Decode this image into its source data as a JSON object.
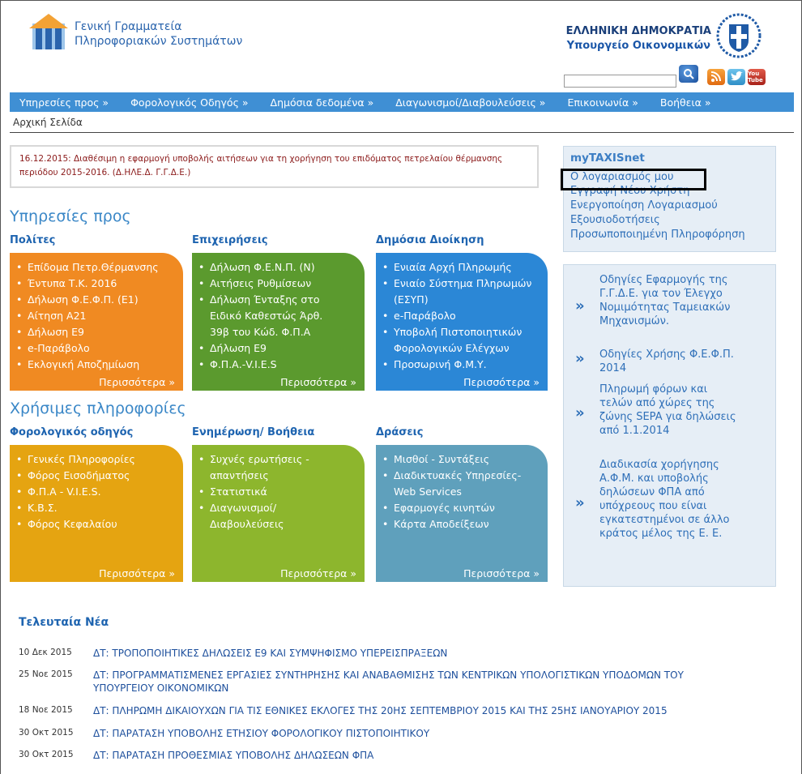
{
  "header": {
    "brand_line1": "Γενική Γραμματεία",
    "brand_line2": "Πληροφοριακών Συστημάτων",
    "gov_line1": "ΕΛΛΗΝΙΚΗ ΔΗΜΟΚΡΑΤΙΑ",
    "gov_line2": "Υπουργείο Οικονομικών",
    "search_value": "",
    "youtube_label": "You Tube"
  },
  "nav": {
    "items": [
      "Υπηρεσίες προς »",
      "Φορολογικός Οδηγός »",
      "Δημόσια δεδομένα »",
      "Διαγωνισμοί/Διαβουλεύσεις »",
      "Επικοινωνία »",
      "Βοήθεια »"
    ]
  },
  "breadcrumb": "Αρχική Σελίδα",
  "notice": "16.12.2015: Διαθέσιμη η εφαρμογή υποβολής αιτήσεων για τη χορήγηση του επιδόματος πετρελαίου θέρμανσης περιόδου 2015-2016. (Δ.ΗΛΕ.Δ. Γ.Γ.Δ.Ε.)",
  "services": {
    "title": "Υπηρεσίες προς",
    "columns": [
      {
        "title": "Πολίτες",
        "items": [
          "Επίδομα Πετρ.Θέρμανσης",
          "Έντυπα Τ.Κ. 2016",
          "Δήλωση Φ.Ε.Φ.Π. (Ε1)",
          "Αίτηση Α21",
          "Δήλωση Ε9",
          "e-Παράβολο",
          "Εκλογική Αποζημίωση"
        ],
        "more": "Περισσότερα »"
      },
      {
        "title": "Επιχειρήσεις",
        "items": [
          "Δήλωση Φ.Ε.Ν.Π. (Ν)",
          "Αιτήσεις Ρυθμίσεων",
          "Δήλωση Ένταξης στο Ειδικό Καθεστώς  Άρθ. 39β του Κώδ. Φ.Π.Α",
          "Δήλωση Ε9",
          "Φ.Π.Α.-V.I.E.S"
        ],
        "more": "Περισσότερα »"
      },
      {
        "title": "Δημόσια Διοίκηση",
        "items": [
          "Ενιαία Αρχή Πληρωμής",
          "Ενιαίο Σύστημα Πληρωμών (ΕΣΥΠ)",
          "e-Παράβολο",
          "Υποβολή Πιστοποιητικών Φορολογικών Ελέγχων",
          "Προσωρινή Φ.Μ.Υ."
        ],
        "more": "Περισσότερα »"
      }
    ]
  },
  "useful": {
    "title": "Χρήσιμες πληροφορίες",
    "columns": [
      {
        "title": "Φορολογικός οδηγός",
        "items": [
          "Γενικές Πληροφορίες",
          "Φόρος Εισοδήματος",
          "Φ.Π.Α - V.I.E.S.",
          "Κ.Β.Σ.",
          "Φόρος Κεφαλαίου"
        ],
        "more": "Περισσότερα »"
      },
      {
        "title": "Ενημέρωση/ Βοήθεια",
        "items": [
          "Συχνές ερωτήσεις - απαντήσεις",
          "Στατιστικά",
          "Διαγωνισμοί/ Διαβουλεύσεις"
        ],
        "more": "Περισσότερα »"
      },
      {
        "title": "Δράσεις",
        "items": [
          "Μισθοί - Συντάξεις",
          "Διαδικτυακές Υπηρεσίες-Web Services",
          "Εφαρμογές κινητών",
          "Κάρτα Αποδείξεων"
        ],
        "more": "Περισσότερα »"
      }
    ]
  },
  "mytaxisnet": {
    "title": "myTAXISnet",
    "links": [
      "Ο λογαριασμός μου",
      "Εγγραφή Νέου Χρήστη",
      "Ενεργοποίηση Λογαριασμού",
      "Εξουσιοδοτήσεις",
      "Προσωποποιημένη Πληροφόρηση"
    ]
  },
  "info_links": [
    "Οδηγίες Εφαρμογής της Γ.Γ.Δ.Ε. για τον Έλεγχο Νομιμότητας Ταμειακών Μηχανισμών.",
    "Οδηγίες Χρήσης Φ.Ε.Φ.Π. 2014",
    "Πληρωμή φόρων και τελών από χώρες της ζώνης SEPA για δηλώσεις από 1.1.2014",
    "Διαδικασία χορήγησης Α.Φ.Μ. και υποβολής δηλώσεων ΦΠΑ από υπόχρεους που είναι εγκατεστημένοι σε άλλο κράτος μέλος της Ε. Ε."
  ],
  "info_arrow": "»",
  "news": {
    "title": "Τελευταία Νέα",
    "items": [
      {
        "date": "10 Δεκ 2015",
        "text": "ΔΤ: ΤΡΟΠΟΠΟΙΗΤΙΚΕΣ ΔΗΛΩΣΕΙΣ Ε9 ΚΑΙ ΣΥΜΨΗΦΙΣΜΟ ΥΠΕΡΕΙΣΠΡΑΞΕΩΝ"
      },
      {
        "date": "25 Νοε 2015",
        "text": "ΔΤ: ΠΡΟΓΡΑΜΜΑΤΙΣΜΕΝΕΣ ΕΡΓΑΣΙΕΣ ΣΥΝΤΗΡΗΣΗΣ ΚΑΙ ΑΝΑΒΑΘΜΙΣΗΣ ΤΩΝ ΚΕΝΤΡΙΚΩΝ ΥΠΟΛΟΓΙΣΤΙΚΩΝ ΥΠΟΔΟΜΩΝ ΤΟΥ ΥΠΟΥΡΓΕΙΟΥ ΟΙΚΟΝΟΜΙΚΩΝ"
      },
      {
        "date": "18 Νοε 2015",
        "text": "ΔΤ: ΠΛΗΡΩΜΗ ΔΙΚΑΙΟΥΧΩΝ ΓΙΑ ΤΙΣ ΕΘΝΙΚΕΣ ΕΚΛΟΓΕΣ ΤΗΣ 20ΗΣ ΣΕΠΤΕΜΒΡΙΟΥ 2015 ΚΑΙ ΤΗΣ 25ΗΣ ΙΑΝΟΥΑΡΙΟΥ 2015"
      },
      {
        "date": "30 Οκτ 2015",
        "text": "ΔΤ: ΠΑΡΑΤΑΣΗ ΥΠΟΒΟΛΗΣ ΕΤΗΣΙΟΥ ΦΟΡΟΛΟΓΙΚΟΥ ΠΙΣΤΟΠΟΙΗΤΙΚΟΥ"
      },
      {
        "date": "30 Οκτ 2015",
        "text": "ΔΤ: ΠΑΡΑΤΑΣΗ ΠΡΟΘΕΣΜΙΑΣ ΥΠΟΒΟΛΗΣ ΔΗΛΩΣΕΩΝ ΦΠΑ"
      }
    ]
  },
  "colors": {
    "nav": "#3f8fd4",
    "box_politis": "#f08a22",
    "box_epixeiriseis": "#5b9a2e",
    "box_dimosia": "#2b87d6",
    "box_odigos": "#e5a411",
    "box_enimerosi": "#8db62d",
    "box_draseis": "#5fa0bc"
  }
}
